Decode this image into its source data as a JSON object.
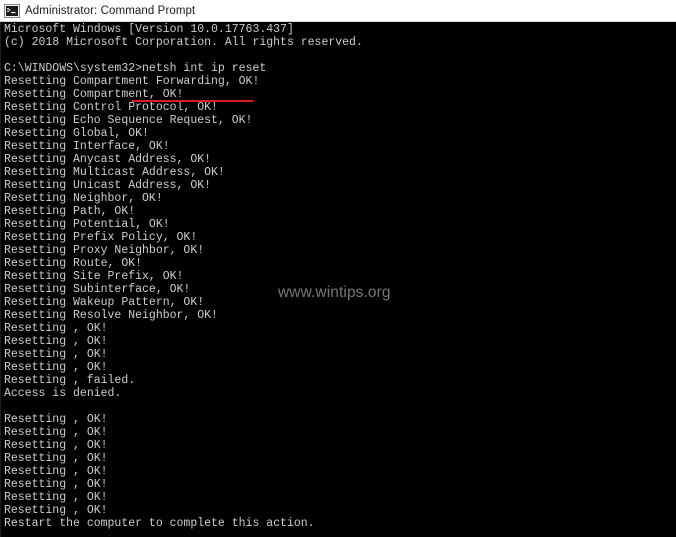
{
  "window": {
    "title": "Administrator: Command Prompt",
    "icon": "command-prompt-icon",
    "titlebar_bg": "#ffffff",
    "console_bg": "#000000",
    "console_fg": "#cdcdcd"
  },
  "annotation": {
    "underline_color": "#e01b1b",
    "underlines_text": "netsh int ip reset"
  },
  "watermark": {
    "text": "www.wintips.org",
    "color": "#e9e9e9"
  },
  "console": {
    "prompt_path": "C:\\WINDOWS\\system32>",
    "command": "netsh int ip reset",
    "lines": [
      "Microsoft Windows [Version 10.0.17763.437]",
      "(c) 2018 Microsoft Corporation. All rights reserved.",
      "",
      "C:\\WINDOWS\\system32>netsh int ip reset",
      "Resetting Compartment Forwarding, OK!",
      "Resetting Compartment, OK!",
      "Resetting Control Protocol, OK!",
      "Resetting Echo Sequence Request, OK!",
      "Resetting Global, OK!",
      "Resetting Interface, OK!",
      "Resetting Anycast Address, OK!",
      "Resetting Multicast Address, OK!",
      "Resetting Unicast Address, OK!",
      "Resetting Neighbor, OK!",
      "Resetting Path, OK!",
      "Resetting Potential, OK!",
      "Resetting Prefix Policy, OK!",
      "Resetting Proxy Neighbor, OK!",
      "Resetting Route, OK!",
      "Resetting Site Prefix, OK!",
      "Resetting Subinterface, OK!",
      "Resetting Wakeup Pattern, OK!",
      "Resetting Resolve Neighbor, OK!",
      "Resetting , OK!",
      "Resetting , OK!",
      "Resetting , OK!",
      "Resetting , OK!",
      "Resetting , failed.",
      "Access is denied.",
      "",
      "Resetting , OK!",
      "Resetting , OK!",
      "Resetting , OK!",
      "Resetting , OK!",
      "Resetting , OK!",
      "Resetting , OK!",
      "Resetting , OK!",
      "Resetting , OK!",
      "Restart the computer to complete this action."
    ]
  }
}
